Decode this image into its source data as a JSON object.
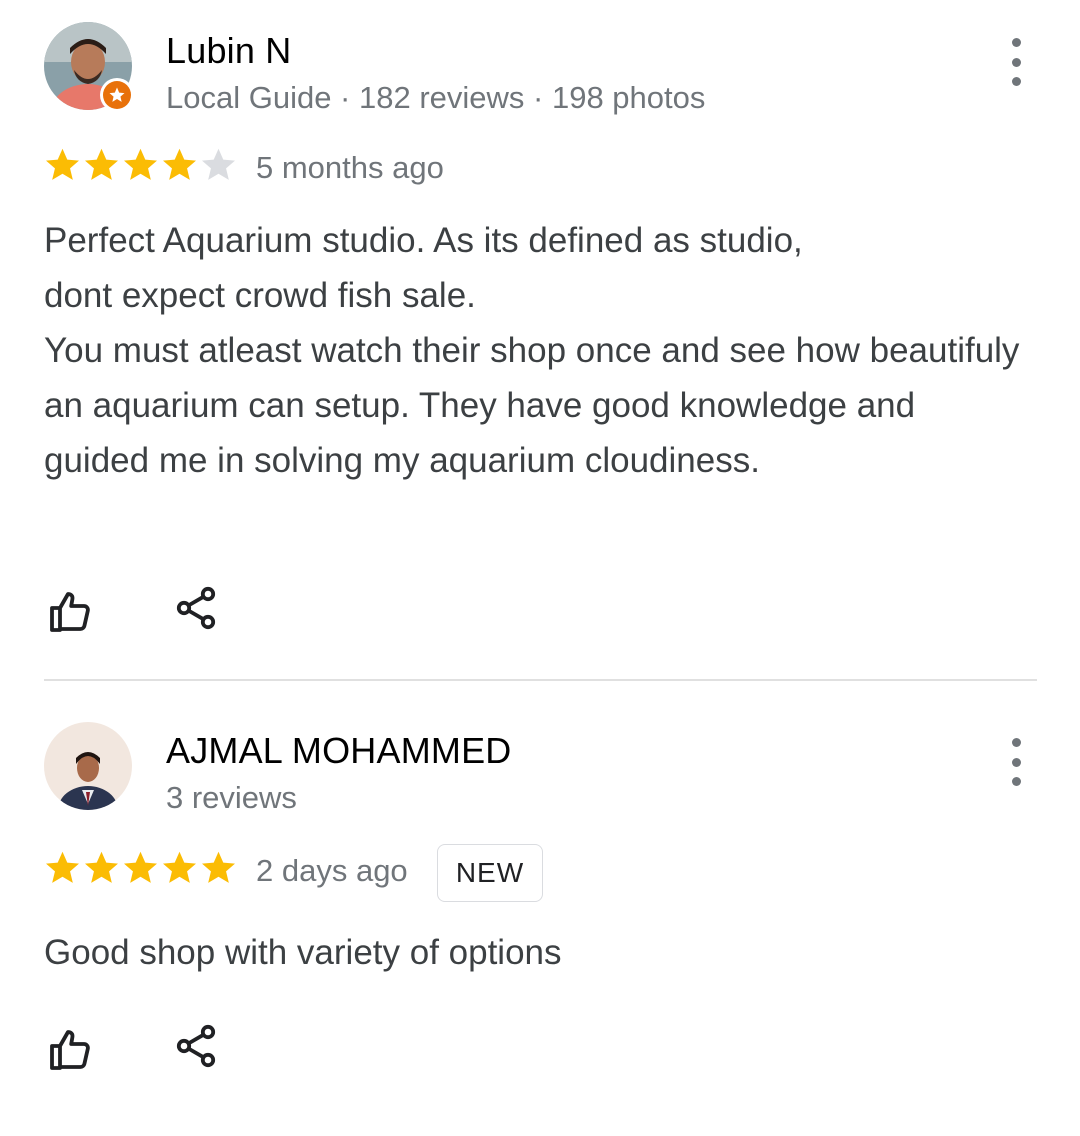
{
  "reviews": [
    {
      "author": "Lubin N",
      "meta": "Local Guide · 182 reviews · 198 photos",
      "local_guide": true,
      "rating": 4,
      "rating_max": 5,
      "time": "5 months ago",
      "badge": "",
      "text": "Perfect Aquarium studio. As its defined as studio,\ndont expect crowd fish sale.\nYou must atleast watch their shop once and see how beautifuly an aquarium can setup. They have good knowledge and guided me in solving my aquarium cloudiness.",
      "actions": [
        "thumbs-up-icon",
        "share-icon"
      ]
    },
    {
      "author": "AJMAL MOHAMMED",
      "meta": "3 reviews",
      "local_guide": false,
      "rating": 5,
      "rating_max": 5,
      "time": "2 days ago",
      "badge": "NEW",
      "text": "Good shop with variety of options",
      "actions": [
        "thumbs-up-icon",
        "share-icon"
      ]
    }
  ],
  "colors": {
    "star_filled": "#fbbc04",
    "star_empty": "#dadce0",
    "local_guide_badge": "#e8710a",
    "meta_text": "#70757a"
  }
}
